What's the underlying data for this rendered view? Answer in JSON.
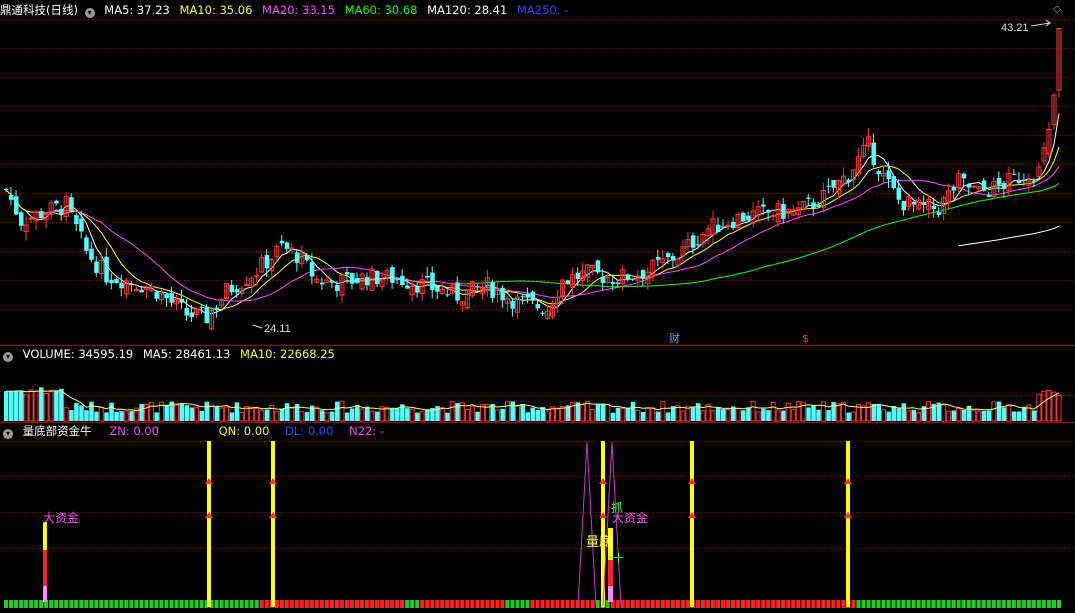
{
  "main_panel": {
    "stock_name": "鼎通科技(日线)",
    "ma_labels": [
      {
        "text": "MA5: 37.23",
        "color": "#ffffff"
      },
      {
        "text": "MA10: 35.06",
        "color": "#ffff00"
      },
      {
        "text": "MA20: 33.15",
        "color": "#ff44ff"
      },
      {
        "text": "MA60: 30.68",
        "color": "#00ff00"
      },
      {
        "text": "MA120: 28.41",
        "color": "#ffffff"
      },
      {
        "text": "MA250: -",
        "color": "#3344ff"
      }
    ],
    "high_label": "43.21",
    "low_label": "24.11",
    "marker_cai": "财",
    "marker_dollar": "$"
  },
  "volume_panel": {
    "labels": [
      {
        "text": "VOLUME: 34595.19",
        "color": "#ffffff"
      },
      {
        "text": "MA5: 28461.13",
        "color": "#ffffff"
      },
      {
        "text": "MA10: 22668.25",
        "color": "#ffff00"
      }
    ]
  },
  "indicator_panel": {
    "name": "量底部资金牛",
    "labels": [
      {
        "text": "ZN: 0.00",
        "color": "#ff44ff"
      },
      {
        "text": "QN: 0.00",
        "color": "#ffff00"
      },
      {
        "text": "DL: 0.00",
        "color": "#3344ff"
      },
      {
        "text": "N22: -",
        "color": "#ff44ff"
      }
    ],
    "annotations": {
      "big_fund_1": "大资金",
      "big_fund_2": "大资金",
      "volume_bottom": "量底",
      "grab": "抓",
      "ten": "十"
    }
  },
  "colors": {
    "up": "#ff3333",
    "down": "#54ffff",
    "grid": "#8b0000"
  }
}
